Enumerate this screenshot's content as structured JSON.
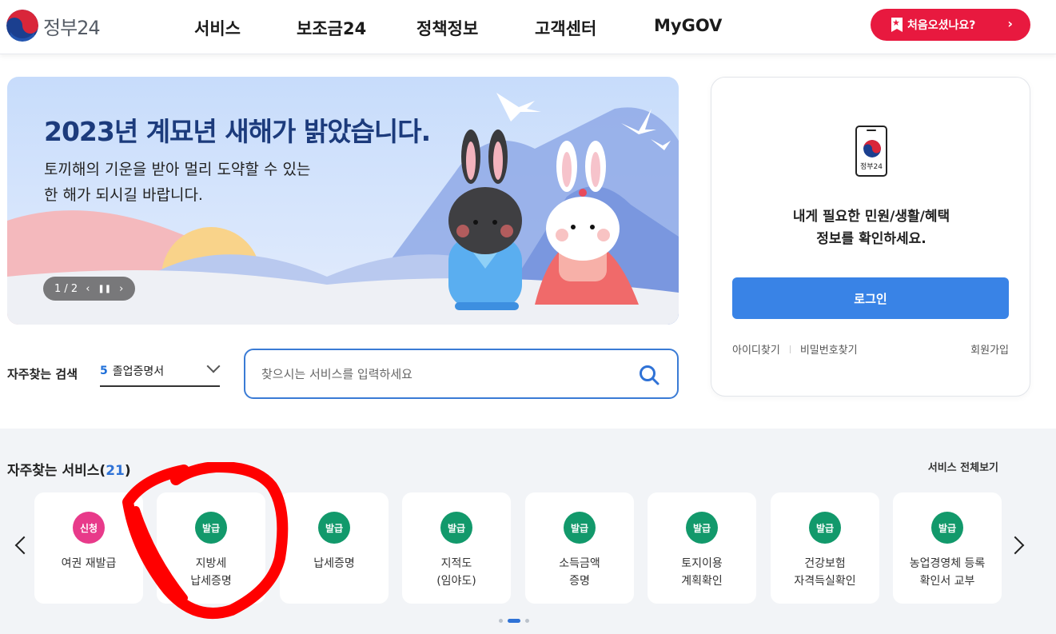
{
  "header": {
    "logo_text": "정부24",
    "nav": [
      {
        "label": "서비스"
      },
      {
        "label": "보조금24"
      },
      {
        "label": "정책정보"
      },
      {
        "label": "고객센터"
      },
      {
        "label": "MyGOV"
      }
    ],
    "first_visit_label": "처음오셨나요?"
  },
  "banner": {
    "title": "2023년 계묘년 새해가 밝았습니다.",
    "subtitle_line1": "토끼해의 기운을 받아 멀리 도약할 수 있는",
    "subtitle_line2": "한 해가 되시길 바랍니다.",
    "pager": "1 / 2"
  },
  "search": {
    "frequent_label": "자주찾는 검색",
    "frequent_rank": "5",
    "frequent_term": "졸업증명서",
    "placeholder": "찾으시는 서비스를 입력하세요"
  },
  "login": {
    "phone_label": "정부24",
    "message_line1": "내게 필요한 민원/생활/혜택",
    "message_line2": "정보를 확인하세요.",
    "login_button": "로그인",
    "find_id": "아이디찾기",
    "find_pw": "비밀번호찾기",
    "signup": "회원가입"
  },
  "services": {
    "title": "자주찾는 서비스",
    "count_open": "(",
    "count": "21",
    "count_close": ")",
    "view_all": "서비스 전체보기",
    "items": [
      {
        "badge": "신청",
        "line1": "여권 재발급",
        "line2": ""
      },
      {
        "badge": "발급",
        "line1": "지방세",
        "line2": "납세증명"
      },
      {
        "badge": "발급",
        "line1": "납세증명",
        "line2": ""
      },
      {
        "badge": "발급",
        "line1": "지적도",
        "line2": "(임야도)"
      },
      {
        "badge": "발급",
        "line1": "소득금액",
        "line2": "증명"
      },
      {
        "badge": "발급",
        "line1": "토지이용",
        "line2": "계획확인"
      },
      {
        "badge": "발급",
        "line1": "건강보험",
        "line2": "자격득실확인"
      },
      {
        "badge": "발급",
        "line1": "농업경영체 등록",
        "line2": "확인서 교부"
      }
    ]
  },
  "colors": {
    "accent_blue": "#3983e6",
    "badge_apply": "#e83a8a",
    "badge_issue": "#12996b",
    "first_visit_red": "#e8193f",
    "annotation_red": "#ff0000"
  }
}
